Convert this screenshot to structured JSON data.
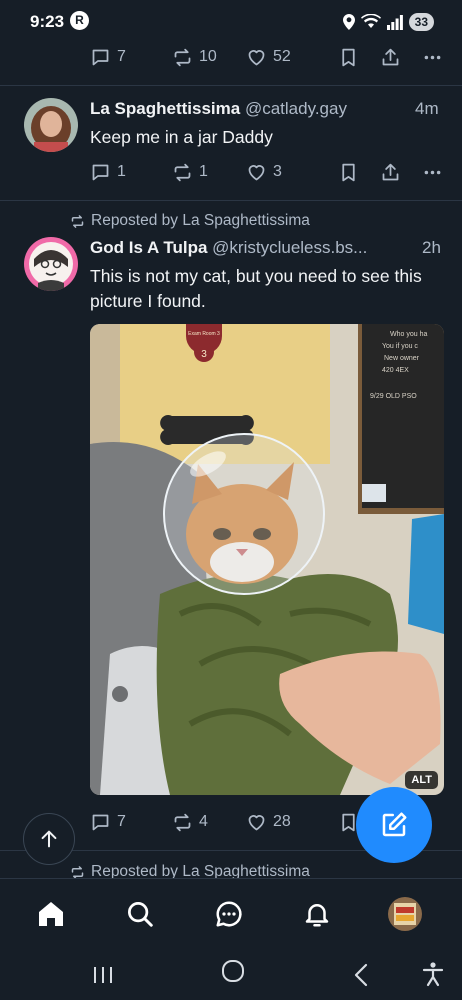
{
  "status_bar": {
    "time": "9:23",
    "left_icon_glyph": "R",
    "battery": "33"
  },
  "top_post_actions": {
    "replies": "7",
    "reposts": "10",
    "likes": "52"
  },
  "post1": {
    "display_name": "La Spaghettissima",
    "handle": "@catlady.gay",
    "time_ago": "4m",
    "text": "Keep me in a jar Daddy",
    "replies": "1",
    "reposts": "1",
    "likes": "3"
  },
  "post2": {
    "repost_label": "Reposted by La Spaghettissima",
    "display_name": "God Is A Tulpa",
    "handle": "@kristyclueless.bs...",
    "time_ago": "2h",
    "text": "This is not my cat, but you need to see this picture I found.",
    "image_alt_badge": "ALT",
    "sign_text": "Exam Room 3",
    "chalkboard_lines": [
      "Who you ha",
      "You if you c",
      "New owner",
      "420 4EX",
      "9/29 OLD PSO"
    ],
    "replies": "7",
    "reposts": "4",
    "likes": "28"
  },
  "post3": {
    "repost_label": "Reposted by La Spaghettissima"
  },
  "colors": {
    "background": "#161e27",
    "accent": "#208bfe",
    "muted": "#aeb9c7"
  }
}
